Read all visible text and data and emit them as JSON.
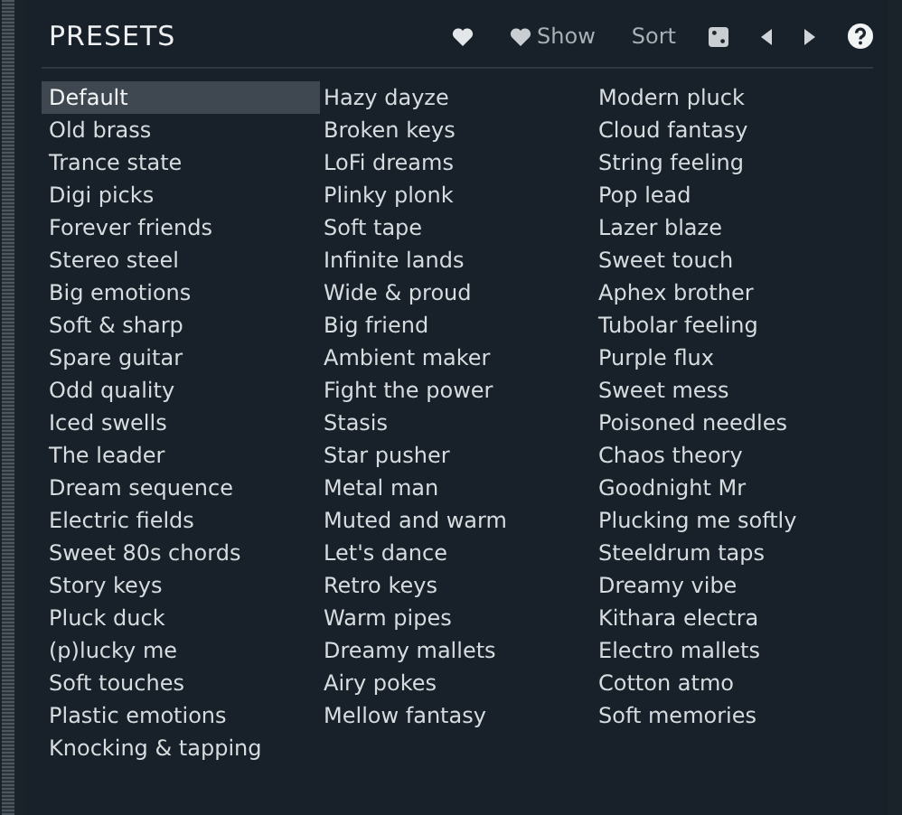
{
  "title": "PRESETS",
  "toolbar": [
    {
      "kind": "heart"
    },
    {
      "kind": "heart",
      "label": "Show"
    },
    {
      "kind": "text",
      "label": "Sort"
    },
    {
      "kind": "dice"
    },
    {
      "kind": "prev"
    },
    {
      "kind": "next"
    },
    {
      "kind": "help"
    }
  ],
  "columns": [
    [
      {
        "name": "Default",
        "selected": true
      },
      {
        "name": "Old brass",
        "selected": false
      },
      {
        "name": "Trance state",
        "selected": false
      },
      {
        "name": "Digi picks",
        "selected": false
      },
      {
        "name": "Forever friends",
        "selected": false
      },
      {
        "name": "Stereo steel",
        "selected": false
      },
      {
        "name": "Big emotions",
        "selected": false
      },
      {
        "name": "Soft & sharp",
        "selected": false
      },
      {
        "name": "Spare guitar",
        "selected": false
      },
      {
        "name": "Odd quality",
        "selected": false
      },
      {
        "name": "Iced swells",
        "selected": false
      },
      {
        "name": "The leader",
        "selected": false
      },
      {
        "name": "Dream sequence",
        "selected": false
      },
      {
        "name": "Electric fields",
        "selected": false
      },
      {
        "name": "Sweet 80s chords",
        "selected": false
      },
      {
        "name": "Story keys",
        "selected": false
      },
      {
        "name": "Pluck duck",
        "selected": false
      },
      {
        "name": "(p)lucky me",
        "selected": false
      },
      {
        "name": "Soft touches",
        "selected": false
      },
      {
        "name": "Plastic emotions",
        "selected": false
      },
      {
        "name": "Knocking & tapping",
        "selected": false
      }
    ],
    [
      {
        "name": "Hazy dayze",
        "selected": false
      },
      {
        "name": "Broken keys",
        "selected": false
      },
      {
        "name": "LoFi dreams",
        "selected": false
      },
      {
        "name": "Plinky plonk",
        "selected": false
      },
      {
        "name": "Soft tape",
        "selected": false
      },
      {
        "name": "Infinite lands",
        "selected": false
      },
      {
        "name": "Wide & proud",
        "selected": false
      },
      {
        "name": "Big friend",
        "selected": false
      },
      {
        "name": "Ambient maker",
        "selected": false
      },
      {
        "name": "Fight the power",
        "selected": false
      },
      {
        "name": "Stasis",
        "selected": false
      },
      {
        "name": "Star pusher",
        "selected": false
      },
      {
        "name": "Metal man",
        "selected": false
      },
      {
        "name": "Muted and warm",
        "selected": false
      },
      {
        "name": "Let's dance",
        "selected": false
      },
      {
        "name": "Retro keys",
        "selected": false
      },
      {
        "name": "Warm pipes",
        "selected": false
      },
      {
        "name": "Dreamy mallets",
        "selected": false
      },
      {
        "name": "Airy pokes",
        "selected": false
      },
      {
        "name": "Mellow fantasy",
        "selected": false
      }
    ],
    [
      {
        "name": "Modern pluck",
        "selected": false
      },
      {
        "name": "Cloud fantasy",
        "selected": false
      },
      {
        "name": "String feeling",
        "selected": false
      },
      {
        "name": "Pop lead",
        "selected": false
      },
      {
        "name": "Lazer blaze",
        "selected": false
      },
      {
        "name": "Sweet touch",
        "selected": false
      },
      {
        "name": "Aphex brother",
        "selected": false
      },
      {
        "name": "Tubolar feeling",
        "selected": false
      },
      {
        "name": "Purple flux",
        "selected": false
      },
      {
        "name": "Sweet mess",
        "selected": false
      },
      {
        "name": "Poisoned needles",
        "selected": false
      },
      {
        "name": "Chaos theory",
        "selected": false
      },
      {
        "name": "Goodnight Mr",
        "selected": false
      },
      {
        "name": "Plucking me softly",
        "selected": false
      },
      {
        "name": "Steeldrum taps",
        "selected": false
      },
      {
        "name": "Dreamy vibe",
        "selected": false
      },
      {
        "name": "Kithara electra",
        "selected": false
      },
      {
        "name": "Electro mallets",
        "selected": false
      },
      {
        "name": "Cotton atmo",
        "selected": false
      },
      {
        "name": "Soft memories",
        "selected": false
      }
    ]
  ]
}
